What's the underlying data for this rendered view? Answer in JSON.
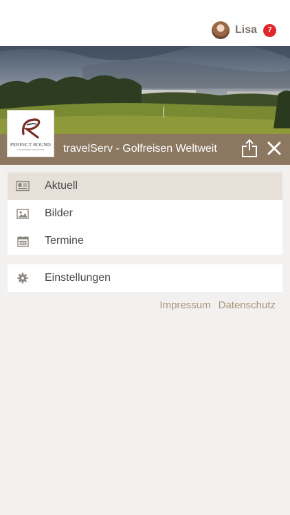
{
  "user": {
    "name": "Lisa",
    "notification_count": "7"
  },
  "brand": {
    "title": "travelServ - Golfreisen Weltweit",
    "logo_text": "PERFECT ROUND",
    "logo_subtext": "GOLFREISEN WELTWEIT",
    "accent_color": "#8c7761"
  },
  "menu": {
    "items": [
      {
        "label": "Aktuell",
        "icon": "newspaper-icon",
        "active": true
      },
      {
        "label": "Bilder",
        "icon": "image-icon",
        "active": false
      },
      {
        "label": "Termine",
        "icon": "calendar-icon",
        "active": false
      }
    ],
    "settings": {
      "label": "Einstellungen",
      "icon": "gear-icon"
    }
  },
  "footer_links": {
    "impressum": "Impressum",
    "datenschutz": "Datenschutz"
  }
}
